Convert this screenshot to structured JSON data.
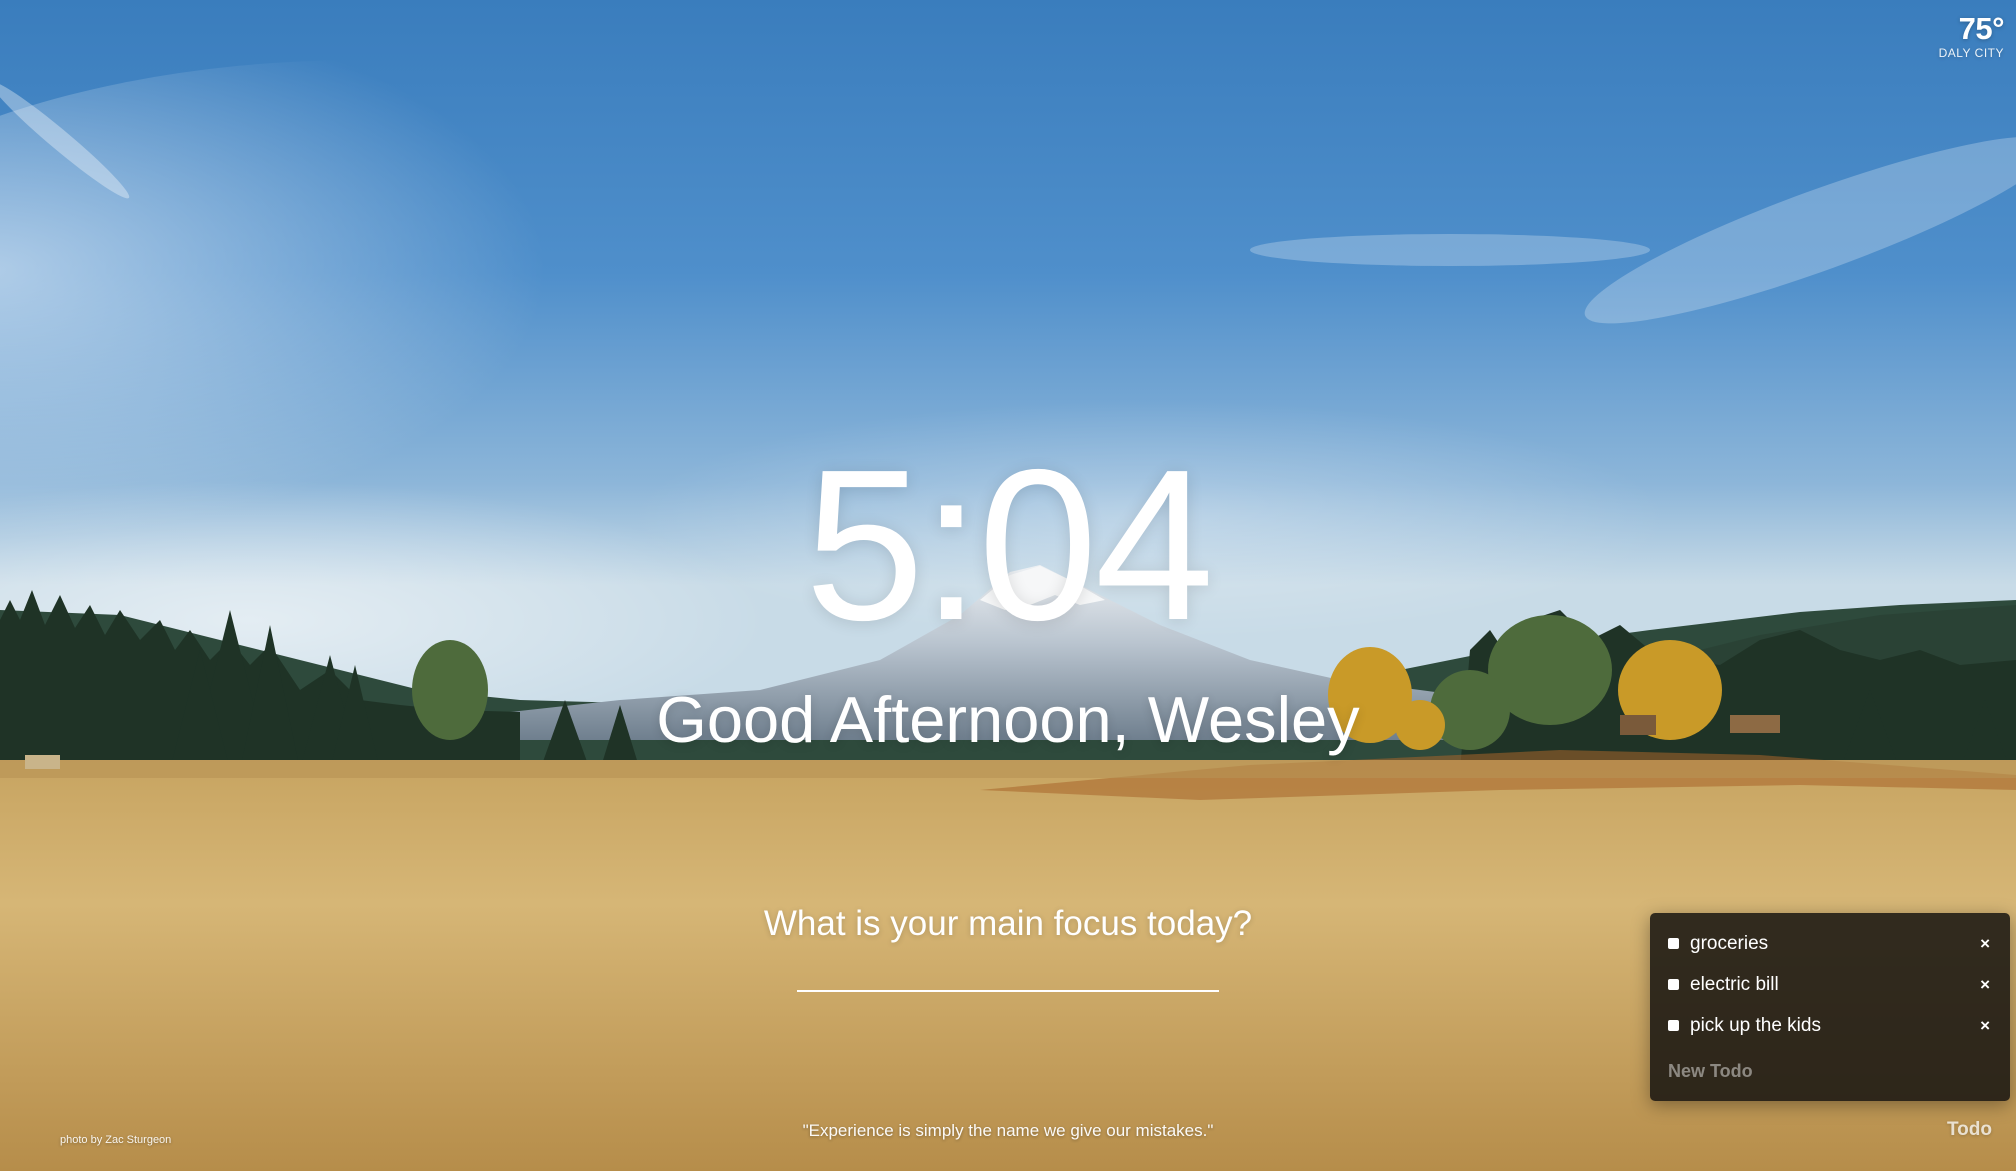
{
  "weather": {
    "temperature": "75°",
    "city": "DALY CITY"
  },
  "clock": {
    "time": "5:04"
  },
  "greeting": {
    "text": "Good Afternoon, Wesley"
  },
  "focus": {
    "question": "What is your main focus today?",
    "value": ""
  },
  "todo": {
    "items": [
      {
        "text": "groceries",
        "delete_label": "×"
      },
      {
        "text": "electric bill",
        "delete_label": "×"
      },
      {
        "text": "pick up the kids",
        "delete_label": "×"
      }
    ],
    "new_placeholder": "New Todo",
    "toggle_label": "Todo"
  },
  "footer": {
    "photo_credit": "photo by Zac Sturgeon",
    "quote": "\"Experience is simply the name we give our mistakes.\""
  },
  "colors": {
    "sky_top": "#2f74b6",
    "sky_horizon": "#c9dbe8",
    "field": "#cfae6b",
    "panel_bg": "#161410"
  }
}
